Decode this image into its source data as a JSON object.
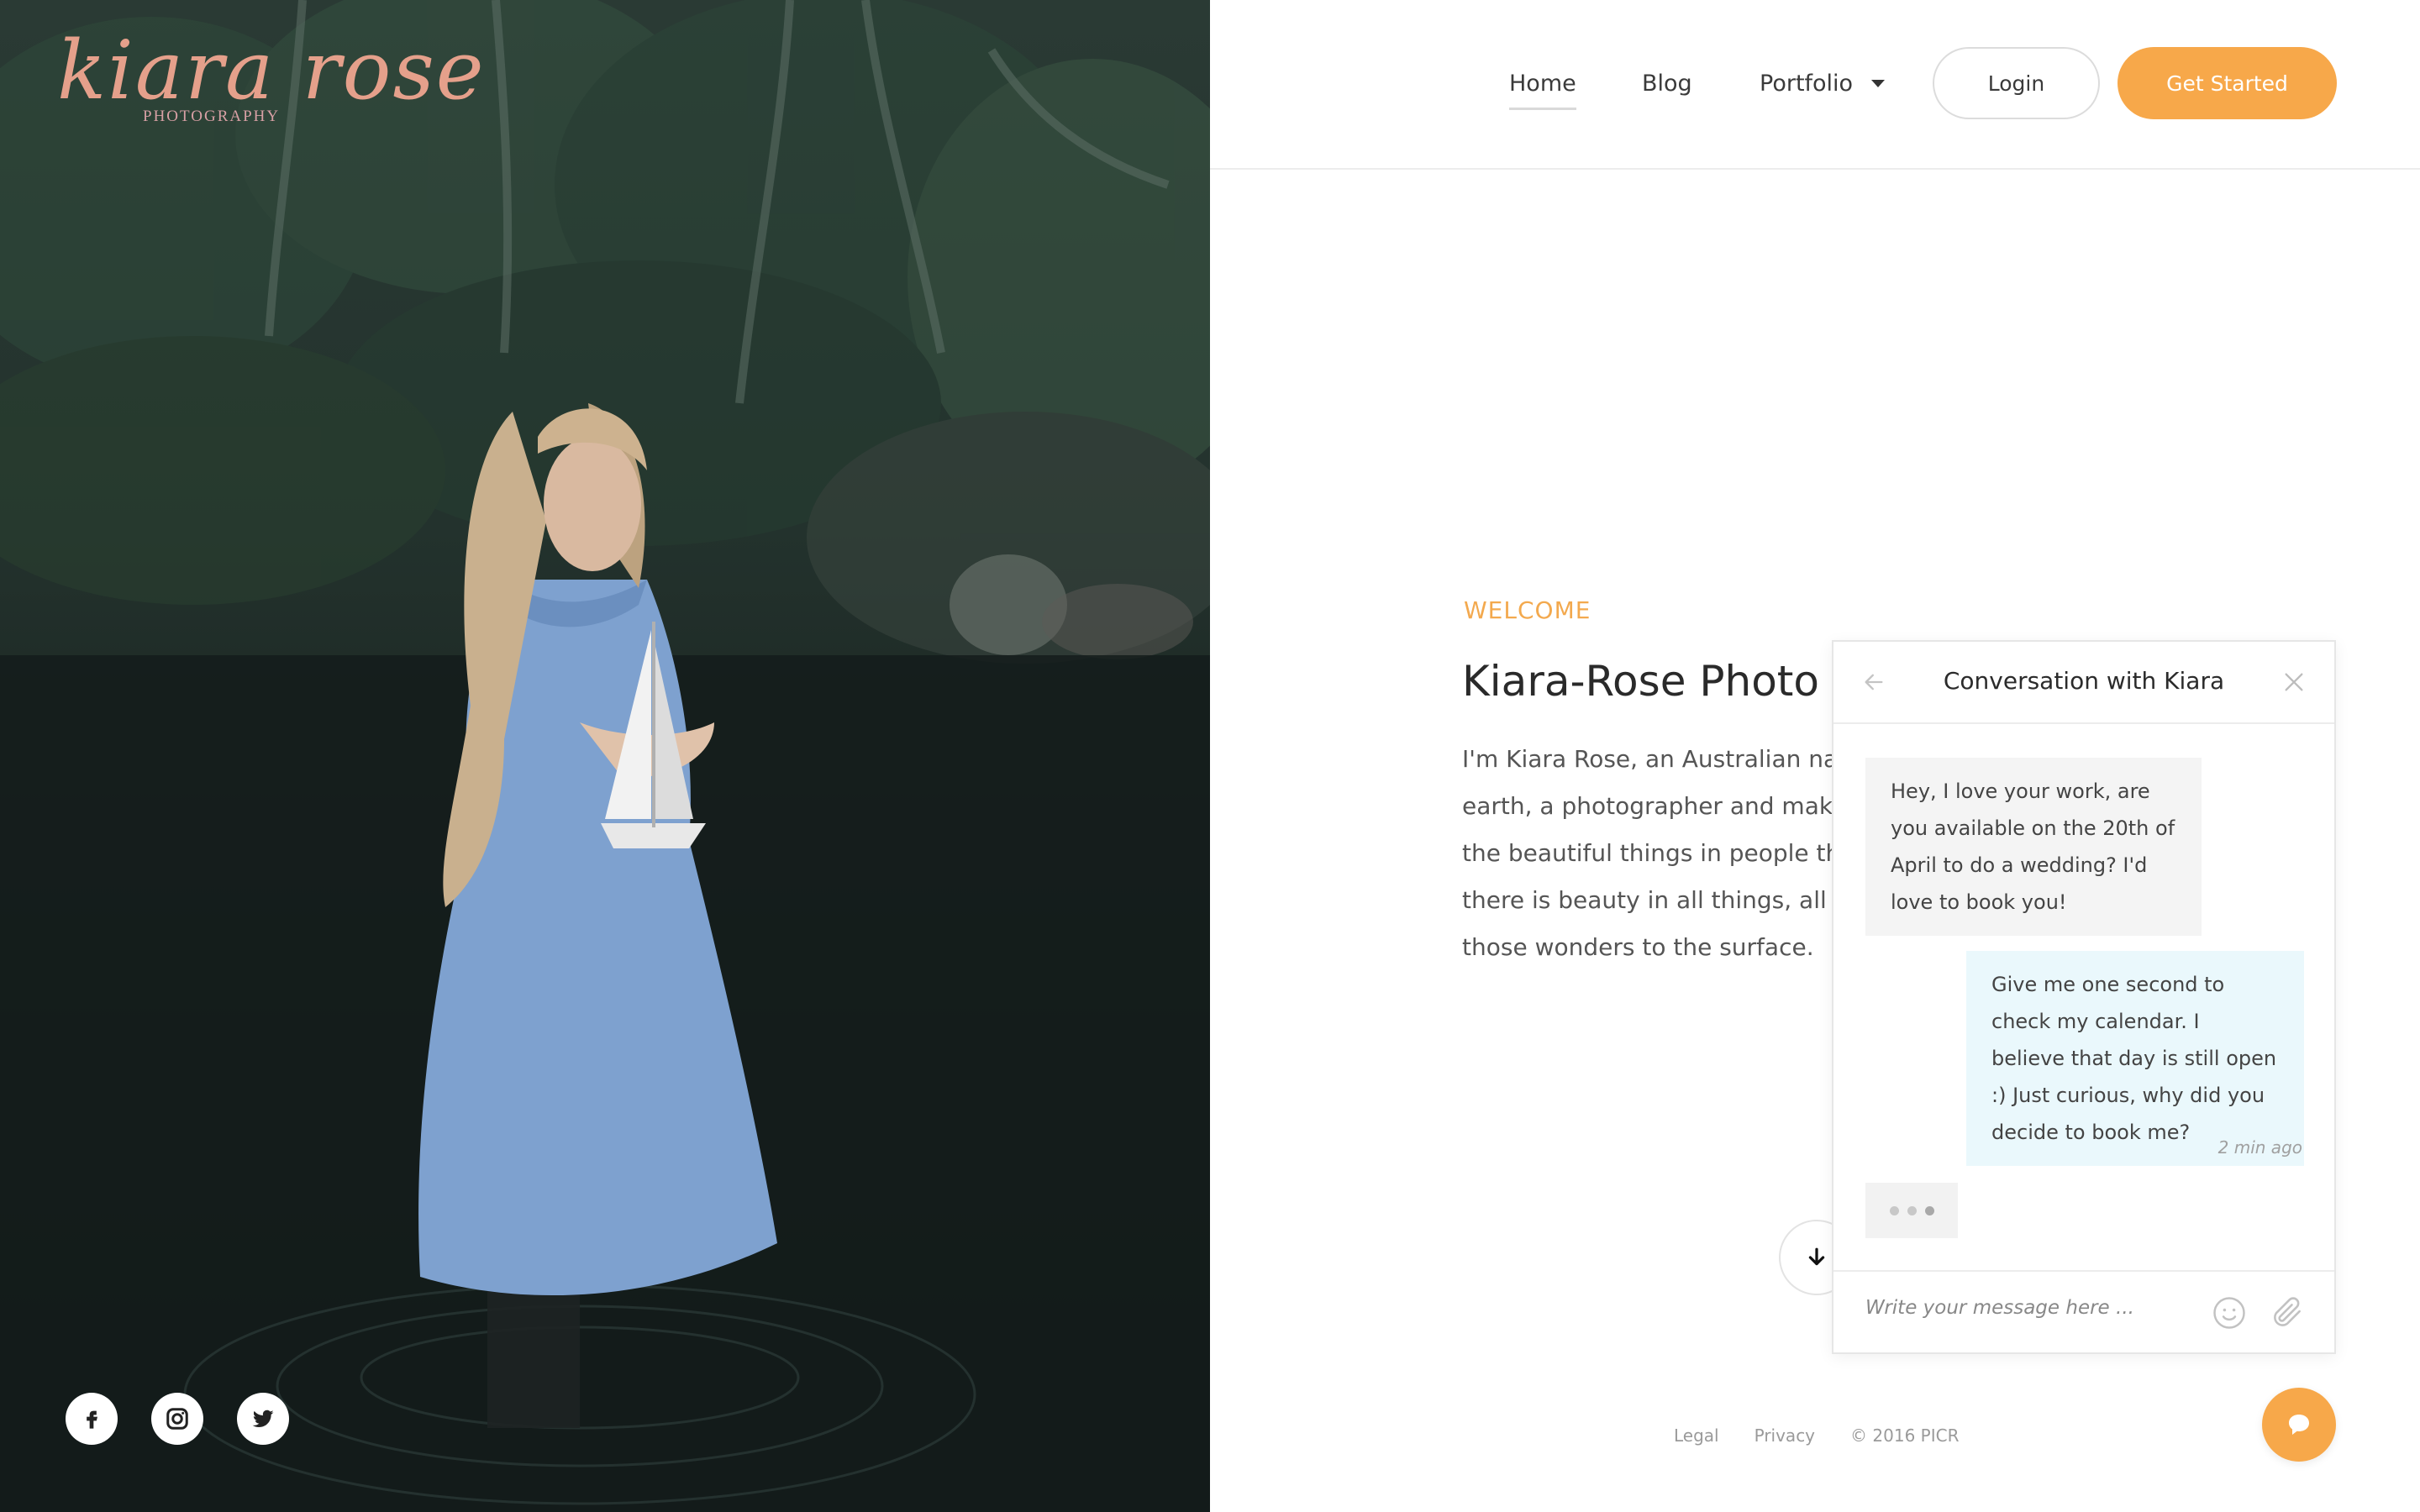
{
  "brand": {
    "logo_script": "kiara rose",
    "logo_sub": "PHOTOGRAPHY"
  },
  "nav": {
    "home": "Home",
    "blog": "Blog",
    "portfolio": "Portfolio",
    "login": "Login",
    "get_started": "Get Started"
  },
  "hero": {
    "eyebrow": "WELCOME",
    "title": "Kiara-Rose Photo",
    "lines": [
      "I'm Kiara Rose, an Australian nativ",
      "earth, a photographer and maker",
      "the beautiful things in people thro",
      "there is beauty in all things, all we",
      "those wonders to the surface."
    ]
  },
  "chat": {
    "title": "Conversation with Kiara",
    "incoming": "Hey, I love your work, are you available on the 20th of April to do a wedding? I'd love to book you!",
    "outgoing": "Give me one second to check my calendar. I believe that day is still open :) Just curious, why did you decide to book me?",
    "timestamp": "2 min ago",
    "input_placeholder": "Write your message here ..."
  },
  "footer": {
    "legal": "Legal",
    "privacy": "Privacy",
    "copyright": "© 2016 PICR"
  },
  "socials": [
    "facebook-icon",
    "instagram-icon",
    "twitter-icon"
  ],
  "colors": {
    "accent": "#f7a84a",
    "welcome": "#f3a94e",
    "outgoing_bubble": "#eaf8fc",
    "incoming_bubble": "#f4f4f4"
  }
}
